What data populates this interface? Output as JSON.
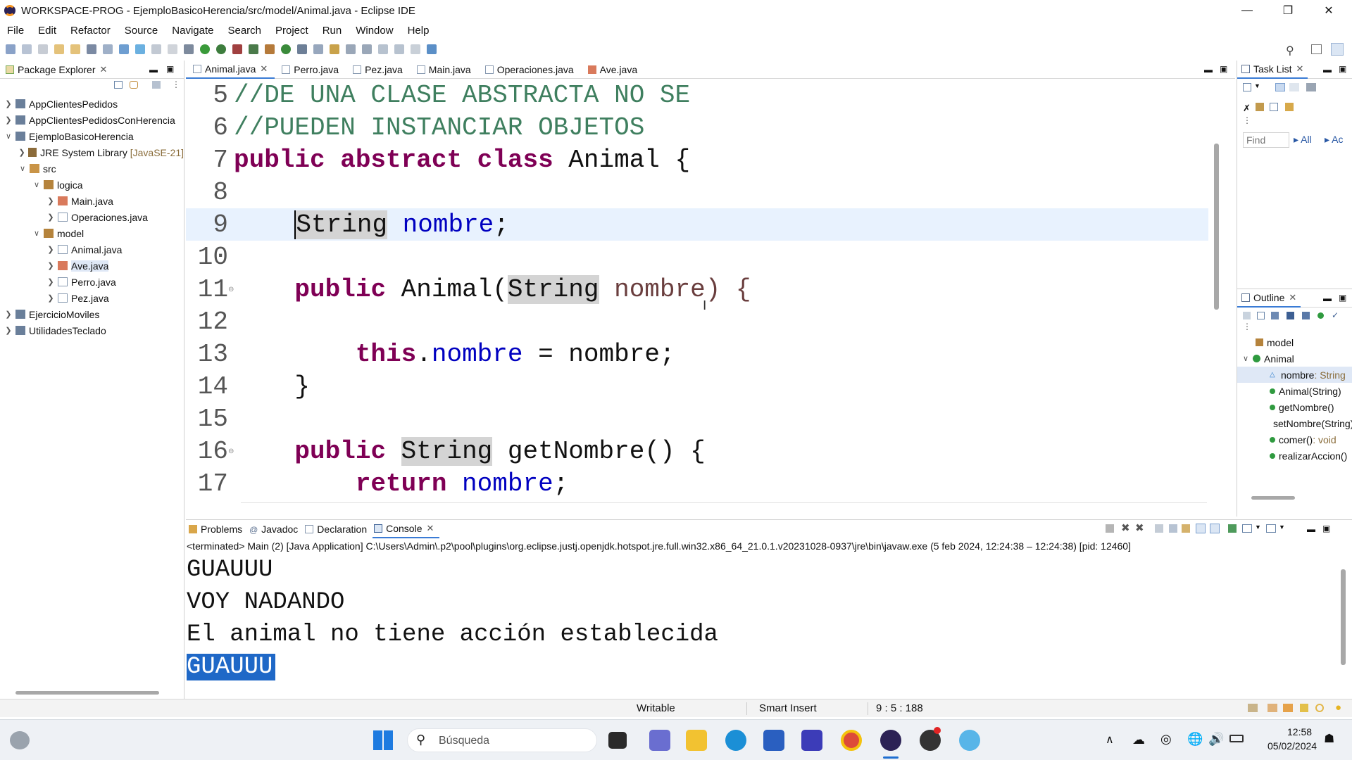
{
  "window": {
    "title": "WORKSPACE-PROG - EjemploBasicoHerencia/src/model/Animal.java - Eclipse IDE"
  },
  "menu": [
    "File",
    "Edit",
    "Refactor",
    "Source",
    "Navigate",
    "Search",
    "Project",
    "Run",
    "Window",
    "Help"
  ],
  "package_explorer": {
    "tab_label": "Package Explorer",
    "items": [
      {
        "label": "AppClientesPedidos"
      },
      {
        "label": "AppClientesPedidosConHerencia"
      },
      {
        "label": "EjemploBasicoHerencia"
      },
      {
        "label": "JRE System Library",
        "suffix": "[JavaSE-21]"
      },
      {
        "label": "src"
      },
      {
        "label": "logica"
      },
      {
        "label": "Main.java"
      },
      {
        "label": "Operaciones.java"
      },
      {
        "label": "model"
      },
      {
        "label": "Animal.java"
      },
      {
        "label": "Ave.java"
      },
      {
        "label": "Perro.java"
      },
      {
        "label": "Pez.java"
      },
      {
        "label": "EjercicioMoviles"
      },
      {
        "label": "UtilidadesTeclado"
      }
    ]
  },
  "editor_tabs": [
    "Animal.java",
    "Perro.java",
    "Pez.java",
    "Main.java",
    "Operaciones.java",
    "Ave.java"
  ],
  "code": {
    "lines": [
      {
        "n": "5",
        "text": "//DE UNA CLASE ABSTRACTA NO SE"
      },
      {
        "n": "6",
        "text": "//PUEDEN INSTANCIAR OBJETOS"
      },
      {
        "n": "7",
        "k1": "public abstract class",
        "t1": " Animal {"
      },
      {
        "n": "8"
      },
      {
        "n": "9",
        "pre": "    ",
        "h": "String",
        "f": " nombre",
        "t": ";"
      },
      {
        "n": "10"
      },
      {
        "n": "11",
        "pre": "    ",
        "k": "public",
        "t1": " Animal(",
        "h": "String",
        "t2": " nombre) {"
      },
      {
        "n": "12"
      },
      {
        "n": "13",
        "pre": "        ",
        "k": "this",
        "t1": ".",
        "f": "nombre",
        "t2": " = nombre;"
      },
      {
        "n": "14",
        "pre": "    ",
        "t": "}"
      },
      {
        "n": "15"
      },
      {
        "n": "16",
        "pre": "    ",
        "k": "public",
        "t1": " ",
        "h": "String",
        "t2": " getNombre() {"
      },
      {
        "n": "17",
        "pre": "        ",
        "k": "return",
        "f": " nombre",
        "t": ";"
      }
    ]
  },
  "task_list": {
    "tab_label": "Task List",
    "find_placeholder": "Find",
    "all_label": "All",
    "ac_label": "Ac"
  },
  "outline": {
    "tab_label": "Outline",
    "items": [
      {
        "label": "model"
      },
      {
        "label": "Animal"
      },
      {
        "label": "nombre",
        "type": " : String"
      },
      {
        "label": "Animal(String)"
      },
      {
        "label": "getNombre()"
      },
      {
        "label": "setNombre(String)"
      },
      {
        "label": "comer()",
        "type": " : void"
      },
      {
        "label": "realizarAccion()"
      }
    ]
  },
  "console": {
    "tabs": [
      "Problems",
      "Javadoc",
      "Declaration",
      "Console"
    ],
    "header": "<terminated> Main (2) [Java Application] C:\\Users\\Admin\\.p2\\pool\\plugins\\org.eclipse.justj.openjdk.hotspot.jre.full.win32.x86_64_21.0.1.v20231028-0937\\jre\\bin\\javaw.exe  (5 feb 2024, 12:24:38 – 12:24:38) [pid: 12460]",
    "lines": [
      "GUAUUU",
      "VOY NADANDO",
      "El animal no tiene acción establecida",
      "GUAUUU"
    ]
  },
  "status": {
    "writable": "Writable",
    "insert": "Smart Insert",
    "position": "9 : 5 : 188"
  },
  "taskbar": {
    "search_placeholder": "Búsqueda",
    "time": "12:58",
    "date": "05/02/2024"
  }
}
